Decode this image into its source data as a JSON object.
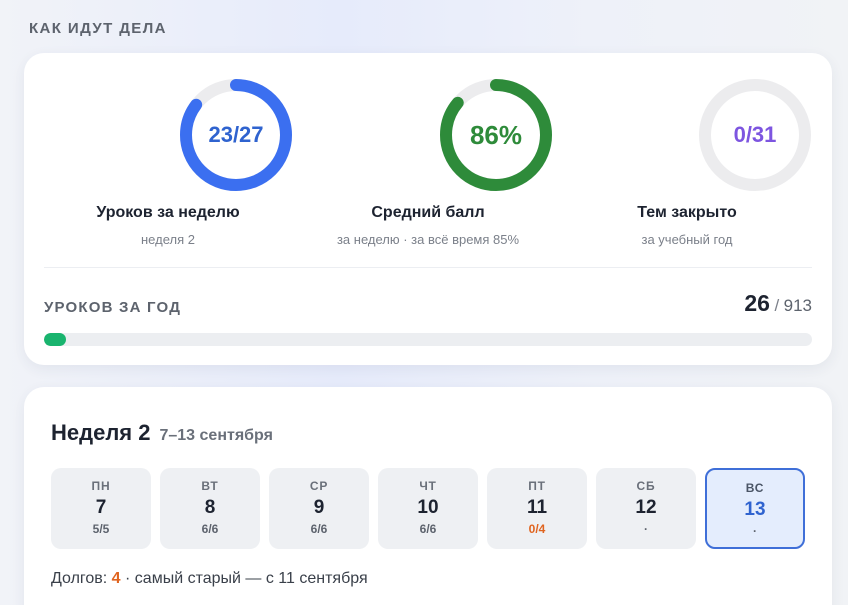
{
  "section_title": "КАК ИДУТ ДЕЛА",
  "stats": [
    {
      "value": "23/27",
      "label": "Уроков за неделю",
      "sub": "неделя 2",
      "fraction": 0.852,
      "color": "#3b6ff0",
      "text_color": "#2f63cf"
    },
    {
      "value": "86%",
      "label": "Средний балл",
      "sub": "за неделю · за всё время 85%",
      "fraction": 0.86,
      "color": "#2e8b3a",
      "text_color": "#2e8b3a"
    },
    {
      "value": "0/31",
      "label": "Тем закрыто",
      "sub": "за учебный год",
      "fraction": 0,
      "color": "#7d55e0",
      "text_color": "#7d55e0"
    }
  ],
  "year": {
    "title": "УРОКОВ ЗА ГОД",
    "done": "26",
    "separator": "/",
    "total": "913",
    "fraction": 0.0285
  },
  "week": {
    "name": "Неделя 2",
    "dates": "7–13 сентября",
    "days": [
      {
        "name": "ПН",
        "num": "7",
        "score": "5/5",
        "state": "normal"
      },
      {
        "name": "ВТ",
        "num": "8",
        "score": "6/6",
        "state": "normal"
      },
      {
        "name": "СР",
        "num": "9",
        "score": "6/6",
        "state": "normal"
      },
      {
        "name": "ЧТ",
        "num": "10",
        "score": "6/6",
        "state": "normal"
      },
      {
        "name": "ПТ",
        "num": "11",
        "score": "0/4",
        "state": "bad"
      },
      {
        "name": "СБ",
        "num": "12",
        "score": "·",
        "state": "normal"
      },
      {
        "name": "ВС",
        "num": "13",
        "score": "·",
        "state": "today"
      }
    ]
  },
  "debts": {
    "prefix": "Долгов: ",
    "count": "4",
    "suffix": " · самый старый — с 11 сентября"
  }
}
